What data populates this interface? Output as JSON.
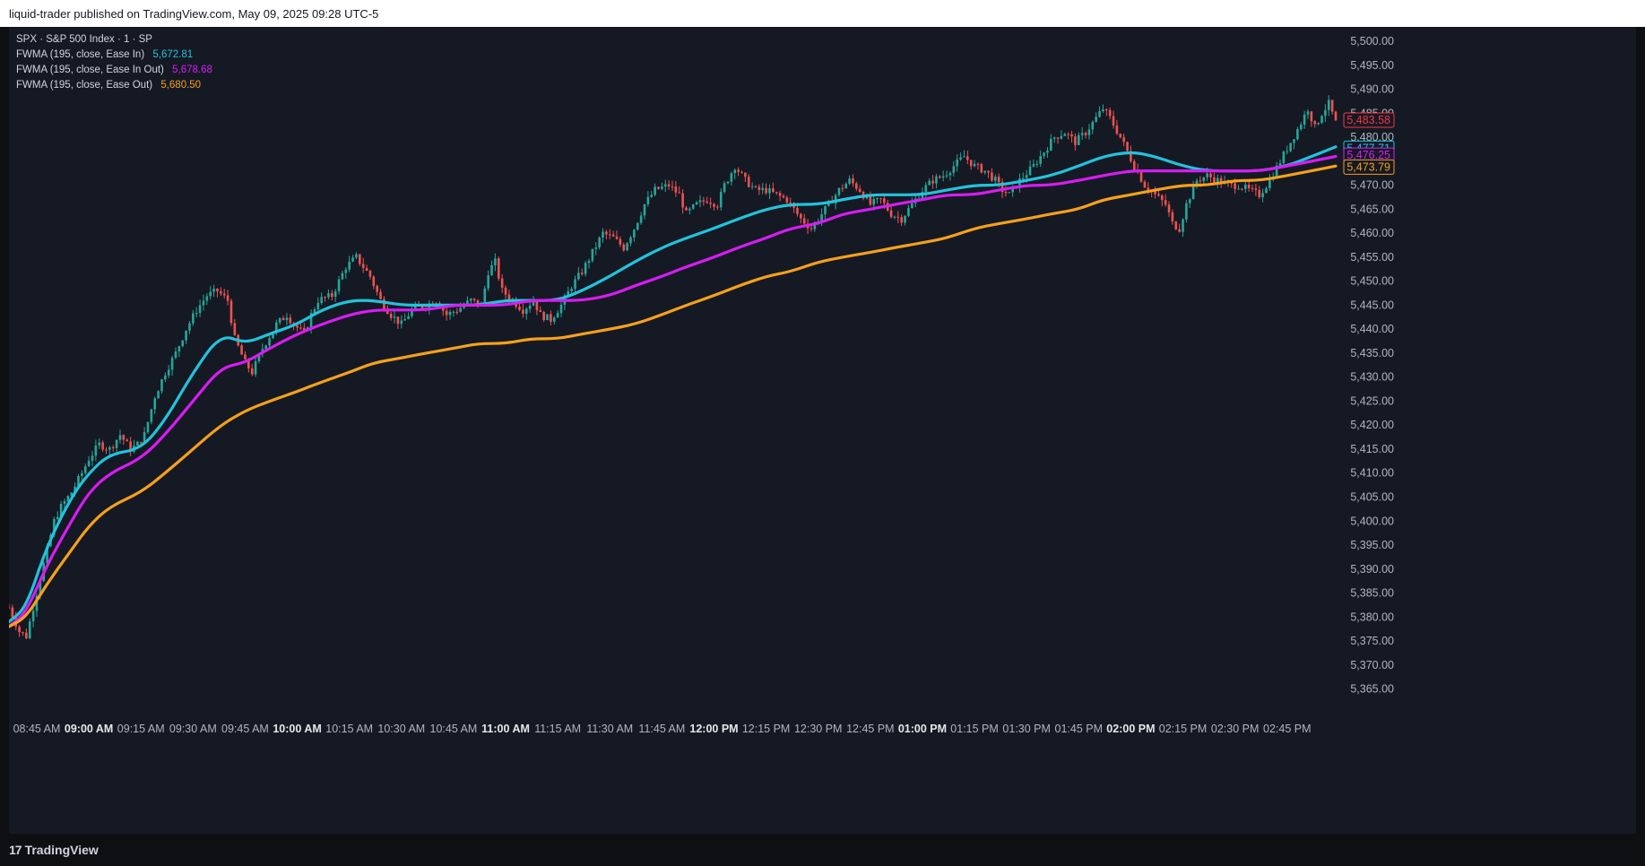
{
  "header": {
    "published": "liquid-trader published on TradingView.com, May 09, 2025 09:28 UTC-5"
  },
  "legend": {
    "symbol_line": "SPX · S&P 500 Index · 1 · SP",
    "indicators": [
      {
        "label": "FWMA (195, close, Ease In)",
        "value": "5,672.81",
        "color": "#22c3dc"
      },
      {
        "label": "FWMA (195, close, Ease In Out)",
        "value": "5,678.68",
        "color": "#d61df2"
      },
      {
        "label": "FWMA (195, close, Ease Out)",
        "value": "5,680.50",
        "color": "#f5a01d"
      }
    ]
  },
  "footer": {
    "brand": "TradingView",
    "brand_mark": "17"
  },
  "chart_data": {
    "type": "line",
    "ylim": [
      5361,
      5503
    ],
    "y_ticks": [
      "5,365.00",
      "5,370.00",
      "5,375.00",
      "5,380.00",
      "5,385.00",
      "5,390.00",
      "5,395.00",
      "5,400.00",
      "5,405.00",
      "5,410.00",
      "5,415.00",
      "5,420.00",
      "5,425.00",
      "5,430.00",
      "5,435.00",
      "5,440.00",
      "5,445.00",
      "5,450.00",
      "5,455.00",
      "5,460.00",
      "5,465.00",
      "5,470.00",
      "5,475.00",
      "5,480.00",
      "5,485.00",
      "5,490.00",
      "5,495.00",
      "5,500.00"
    ],
    "x_ticks": [
      {
        "label": "08:45 AM",
        "t": -15,
        "bold": false
      },
      {
        "label": "09:00 AM",
        "t": 0,
        "bold": true
      },
      {
        "label": "09:15 AM",
        "t": 15,
        "bold": false
      },
      {
        "label": "09:30 AM",
        "t": 30,
        "bold": false
      },
      {
        "label": "09:45 AM",
        "t": 45,
        "bold": false
      },
      {
        "label": "10:00 AM",
        "t": 60,
        "bold": true
      },
      {
        "label": "10:15 AM",
        "t": 75,
        "bold": false
      },
      {
        "label": "10:30 AM",
        "t": 90,
        "bold": false
      },
      {
        "label": "10:45 AM",
        "t": 105,
        "bold": false
      },
      {
        "label": "11:00 AM",
        "t": 120,
        "bold": true
      },
      {
        "label": "11:15 AM",
        "t": 135,
        "bold": false
      },
      {
        "label": "11:30 AM",
        "t": 150,
        "bold": false
      },
      {
        "label": "11:45 AM",
        "t": 165,
        "bold": false
      },
      {
        "label": "12:00 PM",
        "t": 180,
        "bold": true
      },
      {
        "label": "12:15 PM",
        "t": 195,
        "bold": false
      },
      {
        "label": "12:30 PM",
        "t": 210,
        "bold": false
      },
      {
        "label": "12:45 PM",
        "t": 225,
        "bold": false
      },
      {
        "label": "01:00 PM",
        "t": 240,
        "bold": true
      },
      {
        "label": "01:15 PM",
        "t": 255,
        "bold": false
      },
      {
        "label": "01:30 PM",
        "t": 270,
        "bold": false
      },
      {
        "label": "01:45 PM",
        "t": 285,
        "bold": false
      },
      {
        "label": "02:00 PM",
        "t": 300,
        "bold": true
      },
      {
        "label": "02:15 PM",
        "t": 315,
        "bold": false
      },
      {
        "label": "02:30 PM",
        "t": 330,
        "bold": false
      },
      {
        "label": "02:45 PM",
        "t": 345,
        "bold": false
      }
    ],
    "x_range": [
      -23,
      359
    ],
    "price_path": [
      [
        -23,
        5382
      ],
      [
        -20,
        5377
      ],
      [
        -18,
        5376
      ],
      [
        -15,
        5385
      ],
      [
        -12,
        5394
      ],
      [
        -10,
        5400
      ],
      [
        -8,
        5403
      ],
      [
        -5,
        5406
      ],
      [
        -2,
        5410
      ],
      [
        0,
        5413
      ],
      [
        3,
        5416
      ],
      [
        6,
        5415
      ],
      [
        9,
        5418
      ],
      [
        12,
        5415
      ],
      [
        14,
        5416
      ],
      [
        16,
        5418
      ],
      [
        19,
        5426
      ],
      [
        22,
        5431
      ],
      [
        25,
        5435
      ],
      [
        28,
        5440
      ],
      [
        31,
        5444
      ],
      [
        34,
        5447
      ],
      [
        37,
        5448
      ],
      [
        40,
        5446
      ],
      [
        42,
        5438
      ],
      [
        45,
        5433
      ],
      [
        47,
        5431
      ],
      [
        50,
        5436
      ],
      [
        54,
        5441
      ],
      [
        57,
        5443
      ],
      [
        59,
        5441
      ],
      [
        62,
        5439
      ],
      [
        64,
        5443
      ],
      [
        66,
        5446
      ],
      [
        70,
        5447
      ],
      [
        74,
        5453
      ],
      [
        77,
        5455
      ],
      [
        81,
        5451
      ],
      [
        84,
        5446
      ],
      [
        87,
        5443
      ],
      [
        90,
        5441
      ],
      [
        93,
        5444
      ],
      [
        97,
        5445
      ],
      [
        100,
        5446
      ],
      [
        103,
        5443
      ],
      [
        106,
        5444
      ],
      [
        110,
        5446
      ],
      [
        113,
        5445
      ],
      [
        115,
        5452
      ],
      [
        117,
        5454
      ],
      [
        119,
        5448
      ],
      [
        122,
        5446
      ],
      [
        125,
        5444
      ],
      [
        128,
        5446
      ],
      [
        130,
        5443
      ],
      [
        133,
        5442
      ],
      [
        136,
        5445
      ],
      [
        139,
        5449
      ],
      [
        142,
        5452
      ],
      [
        145,
        5456
      ],
      [
        148,
        5460
      ],
      [
        151,
        5459
      ],
      [
        154,
        5457
      ],
      [
        157,
        5461
      ],
      [
        160,
        5466
      ],
      [
        163,
        5469
      ],
      [
        167,
        5470
      ],
      [
        170,
        5468
      ],
      [
        172,
        5464
      ],
      [
        175,
        5466
      ],
      [
        178,
        5467
      ],
      [
        181,
        5466
      ],
      [
        183,
        5470
      ],
      [
        186,
        5474
      ],
      [
        189,
        5471
      ],
      [
        192,
        5469
      ],
      [
        195,
        5469
      ],
      [
        198,
        5468
      ],
      [
        201,
        5467
      ],
      [
        203,
        5465
      ],
      [
        205,
        5463
      ],
      [
        208,
        5461
      ],
      [
        210,
        5463
      ],
      [
        213,
        5466
      ],
      [
        216,
        5469
      ],
      [
        219,
        5471
      ],
      [
        222,
        5469
      ],
      [
        225,
        5466
      ],
      [
        228,
        5467
      ],
      [
        231,
        5464
      ],
      [
        234,
        5463
      ],
      [
        237,
        5466
      ],
      [
        240,
        5469
      ],
      [
        243,
        5471
      ],
      [
        246,
        5472
      ],
      [
        249,
        5474
      ],
      [
        252,
        5476
      ],
      [
        255,
        5474
      ],
      [
        258,
        5473
      ],
      [
        261,
        5471
      ],
      [
        263,
        5469
      ],
      [
        265,
        5468
      ],
      [
        268,
        5471
      ],
      [
        272,
        5474
      ],
      [
        275,
        5477
      ],
      [
        278,
        5480
      ],
      [
        281,
        5481
      ],
      [
        284,
        5479
      ],
      [
        287,
        5481
      ],
      [
        290,
        5484
      ],
      [
        292,
        5486
      ],
      [
        294,
        5484
      ],
      [
        297,
        5480
      ],
      [
        299,
        5477
      ],
      [
        301,
        5474
      ],
      [
        304,
        5470
      ],
      [
        307,
        5468
      ],
      [
        310,
        5466
      ],
      [
        312,
        5462
      ],
      [
        314,
        5461
      ],
      [
        316,
        5466
      ],
      [
        319,
        5471
      ],
      [
        322,
        5472
      ],
      [
        325,
        5471
      ],
      [
        328,
        5470
      ],
      [
        331,
        5470
      ],
      [
        334,
        5469
      ],
      [
        337,
        5468
      ],
      [
        340,
        5471
      ],
      [
        343,
        5475
      ],
      [
        346,
        5479
      ],
      [
        349,
        5483
      ],
      [
        351,
        5486
      ],
      [
        353,
        5482
      ],
      [
        355,
        5485
      ],
      [
        357,
        5487
      ],
      [
        359,
        5483
      ]
    ],
    "series": [
      {
        "name": "FWMA (195, close, Ease In)",
        "color": "#22c3dc",
        "last": "5,477.71",
        "x": [
          -23,
          -18,
          -12,
          -5,
          0,
          6,
          15,
          22,
          30,
          38,
          45,
          52,
          60,
          67,
          75,
          82,
          90,
          97,
          105,
          112,
          120,
          127,
          135,
          142,
          150,
          157,
          165,
          172,
          180,
          187,
          195,
          202,
          210,
          217,
          225,
          232,
          240,
          247,
          255,
          262,
          270,
          277,
          285,
          292,
          300,
          307,
          315,
          322,
          330,
          337,
          345,
          352,
          359
        ],
        "y": [
          5379,
          5382,
          5395,
          5405,
          5410,
          5414,
          5415,
          5421,
          5431,
          5439,
          5437,
          5439,
          5441,
          5444,
          5446,
          5446,
          5445,
          5445,
          5445,
          5445,
          5446,
          5446,
          5446,
          5448,
          5451,
          5454,
          5457,
          5459,
          5461,
          5463,
          5465,
          5466,
          5466,
          5467,
          5468,
          5468,
          5468,
          5469,
          5470,
          5470,
          5471,
          5472,
          5474,
          5476,
          5477,
          5476,
          5474,
          5473,
          5473,
          5473,
          5474,
          5476,
          5478
        ]
      },
      {
        "name": "FWMA (195, close, Ease In Out)",
        "color": "#d61df2",
        "last": "5,476.25",
        "x": [
          -23,
          -18,
          -12,
          -5,
          0,
          6,
          15,
          22,
          30,
          38,
          45,
          52,
          60,
          67,
          75,
          82,
          90,
          97,
          105,
          112,
          120,
          127,
          135,
          142,
          150,
          157,
          165,
          172,
          180,
          187,
          195,
          202,
          210,
          217,
          225,
          232,
          240,
          247,
          255,
          262,
          270,
          277,
          285,
          292,
          300,
          307,
          315,
          322,
          330,
          337,
          345,
          352,
          359
        ],
        "y": [
          5378,
          5381,
          5391,
          5400,
          5406,
          5410,
          5413,
          5418,
          5425,
          5432,
          5433,
          5436,
          5439,
          5441,
          5443,
          5444,
          5444,
          5444,
          5445,
          5445,
          5445,
          5446,
          5446,
          5446,
          5447,
          5449,
          5451,
          5453,
          5455,
          5457,
          5459,
          5461,
          5462,
          5464,
          5465,
          5466,
          5467,
          5468,
          5468,
          5469,
          5470,
          5470,
          5471,
          5472,
          5473,
          5473,
          5473,
          5473,
          5473,
          5473,
          5474,
          5475,
          5476
        ]
      },
      {
        "name": "FWMA (195, close, Ease Out)",
        "color": "#f5a01d",
        "last": "5,473.79",
        "x": [
          -23,
          -18,
          -12,
          -5,
          0,
          6,
          15,
          22,
          30,
          38,
          45,
          52,
          60,
          67,
          75,
          82,
          90,
          97,
          105,
          112,
          120,
          127,
          135,
          142,
          150,
          157,
          165,
          172,
          180,
          187,
          195,
          202,
          210,
          217,
          225,
          232,
          240,
          247,
          255,
          262,
          270,
          277,
          285,
          292,
          300,
          307,
          315,
          322,
          330,
          337,
          345,
          352,
          359
        ],
        "y": [
          5378,
          5380,
          5387,
          5394,
          5399,
          5403,
          5406,
          5410,
          5415,
          5420,
          5423,
          5425,
          5427,
          5429,
          5431,
          5433,
          5434,
          5435,
          5436,
          5437,
          5437,
          5438,
          5438,
          5439,
          5440,
          5441,
          5443,
          5445,
          5447,
          5449,
          5451,
          5452,
          5454,
          5455,
          5456,
          5457,
          5458,
          5459,
          5461,
          5462,
          5463,
          5464,
          5465,
          5467,
          5468,
          5469,
          5470,
          5470,
          5471,
          5471,
          5472,
          5473,
          5474
        ]
      }
    ],
    "last_price": {
      "value": "5,483.58",
      "color": "#f23645"
    }
  }
}
